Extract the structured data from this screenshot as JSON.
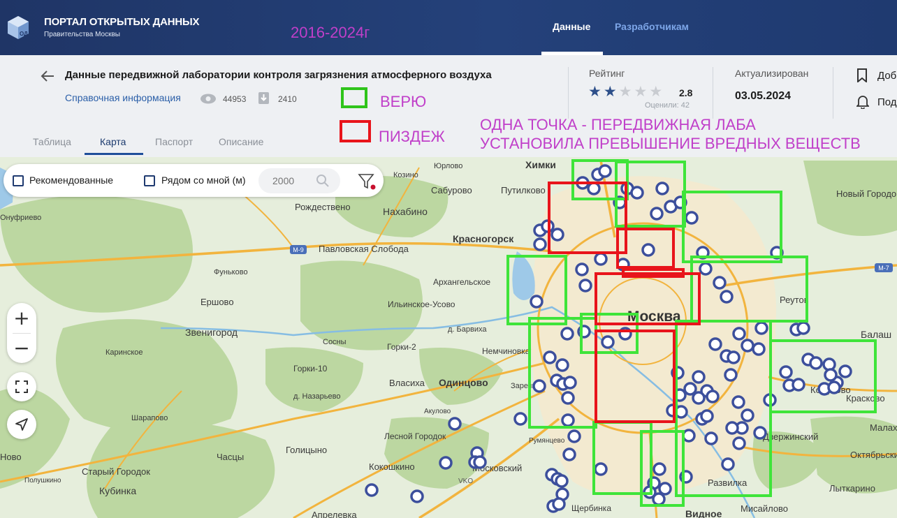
{
  "header": {
    "brand_title": "ПОРТАЛ ОТКРЫТЫХ ДАННЫХ",
    "brand_subtitle": "Правительства Москвы",
    "logo_text": "ОД",
    "nav_data": "Данные",
    "nav_developers": "Разработчикам",
    "annotation_years": "2016-2024г"
  },
  "dataset": {
    "title": "Данные передвижной лаборатории контроля загрязнения атмосферного воздуха",
    "reference_link": "Справочная информация",
    "views": "44953",
    "downloads": "2410"
  },
  "rating": {
    "label": "Рейтинг",
    "value": 2.8,
    "value_text": "2.8",
    "votes_text": "Оценили: 42",
    "stars_total": 5
  },
  "actualized": {
    "label": "Актуализирован",
    "date": "03.05.2024"
  },
  "actions": {
    "bookmark": "Доб",
    "subscribe": "Под"
  },
  "annotations": {
    "green_legend": "ВЕРЮ",
    "red_legend": "ПИЗДЕЖ",
    "note_line1": "ОДНА ТОЧКА - ПЕРЕДВИЖНАЯ ЛАБА",
    "note_line2": "УСТАНОВИЛА ПРЕВЫШЕНИЕ ВРЕДНЫХ ВЕЩЕСТВ",
    "color_text": "#c03fc9",
    "color_green": "#2fc41a",
    "color_red": "#e8141b"
  },
  "tabs": [
    {
      "label": "Таблица",
      "active": false
    },
    {
      "label": "Карта",
      "active": true
    },
    {
      "label": "Паспорт",
      "active": false
    },
    {
      "label": "Описание",
      "active": false
    }
  ],
  "filters": {
    "recommended": "Рекомендованные",
    "near_me": "Рядом со мной (м)",
    "radius_placeholder": "2000"
  },
  "map": {
    "city_label": "Москва",
    "places": [
      "Химки",
      "Козино",
      "Юрлово",
      "Сабурово",
      "Путилково",
      "Новый Городок",
      "Нахабино",
      "Рождествено",
      "Онуфриево",
      "Красногорск",
      "Павловская Слобода",
      "Фуньково",
      "Архангельское",
      "Ильинское-Усово",
      "Ершово",
      "д. Барвиха",
      "Реутов",
      "Балаш",
      "Звенигород",
      "Сосны",
      "Горки-2",
      "Немчиновка",
      "Каринское",
      "Горки-10",
      "Власиха",
      "Одинцово",
      "Заречье",
      "Кожухово",
      "Красково",
      "д. Назарьево",
      "Акулово",
      "Малаховк",
      "Шарапово",
      "Лесной Городок",
      "Румянцево",
      "Дзержинский",
      "Октябрьский",
      "Часцы",
      "Голицыно",
      "Кокошкино",
      "Московский",
      "Развилка",
      "Лыткарино",
      "Кубинка",
      "Старый Городок",
      "Щербинка",
      "Мисайлово",
      "Видное",
      "Апрелевка",
      "Ново",
      "Полушкино"
    ],
    "roads": [
      "М-9",
      "М-7",
      "VKO"
    ]
  },
  "colors": {
    "header_bg": "#1f3566",
    "panel_bg": "#eef0f3",
    "star_filled": "#2d4f8a",
    "star_empty": "#c9ccd1",
    "marker": "#3c4f9c"
  }
}
